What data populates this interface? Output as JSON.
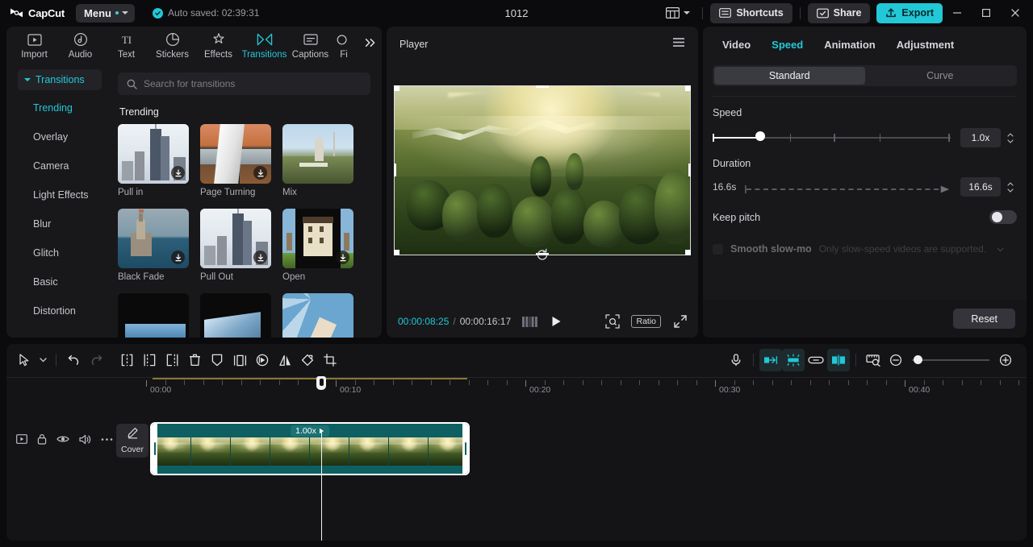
{
  "titlebar": {
    "brand": "CapCut",
    "menu_label": "Menu",
    "autosave": "Auto saved: 02:39:31",
    "project_title": "1012",
    "layout_icon": "layout-icon",
    "shortcuts_label": "Shortcuts",
    "share_label": "Share",
    "export_label": "Export",
    "minimize": "minimize-icon",
    "maximize": "maximize-icon",
    "close": "close-icon",
    "accent": "#22c8d6"
  },
  "media_panel": {
    "tabs": [
      {
        "label": "Import",
        "icon": "import-icon",
        "active": false
      },
      {
        "label": "Audio",
        "icon": "audio-icon",
        "active": false
      },
      {
        "label": "Text",
        "icon": "text-icon",
        "active": false
      },
      {
        "label": "Stickers",
        "icon": "stickers-icon",
        "active": false
      },
      {
        "label": "Effects",
        "icon": "effects-icon",
        "active": false
      },
      {
        "label": "Transitions",
        "icon": "transitions-icon",
        "active": true
      },
      {
        "label": "Captions",
        "icon": "captions-icon",
        "active": false
      },
      {
        "label": "Fi",
        "icon": "filters-icon",
        "active": false
      }
    ],
    "expand_icon": "chevron-double-right-icon",
    "category_header": "Transitions",
    "categories": [
      {
        "label": "Trending",
        "active": true
      },
      {
        "label": "Overlay",
        "active": false
      },
      {
        "label": "Camera",
        "active": false
      },
      {
        "label": "Light Effects",
        "active": false
      },
      {
        "label": "Blur",
        "active": false
      },
      {
        "label": "Glitch",
        "active": false
      },
      {
        "label": "Basic",
        "active": false
      },
      {
        "label": "Distortion",
        "active": false
      }
    ],
    "search": {
      "placeholder": "Search for transitions",
      "value": "",
      "icon": "search-icon"
    },
    "section_title": "Trending",
    "items": [
      {
        "name": "Pull in",
        "art": "tn-city",
        "download": true,
        "selected": true
      },
      {
        "name": "Page Turning",
        "art": "tn-page",
        "download": true,
        "selected": false
      },
      {
        "name": "Mix",
        "art": "tn-hill",
        "download": false,
        "selected": false
      },
      {
        "name": "Black Fade",
        "art": "tn-tower",
        "download": true,
        "selected": false
      },
      {
        "name": "Pull Out",
        "art": "tn-city",
        "download": true,
        "selected": true
      },
      {
        "name": "Open",
        "art": "tn-open",
        "download": true,
        "selected": false
      }
    ]
  },
  "player": {
    "title": "Player",
    "menu_icon": "hamburger-icon",
    "reset_rotation_icon": "reset-rotation-icon",
    "current_time": "00:00:08:25",
    "time_separator": "/",
    "total_time": "00:00:16:17",
    "quality_icon": "quality-bars-icon",
    "play_icon": "play-icon",
    "zoom_fit_icon": "zoom-fit-icon",
    "ratio_label": "Ratio",
    "fullscreen_icon": "fullscreen-icon"
  },
  "inspector": {
    "tabs": [
      {
        "label": "Video",
        "active": false
      },
      {
        "label": "Speed",
        "active": true
      },
      {
        "label": "Animation",
        "active": false
      },
      {
        "label": "Adjustment",
        "active": false
      }
    ],
    "modes": [
      {
        "label": "Standard",
        "active": true
      },
      {
        "label": "Curve",
        "active": false
      }
    ],
    "speed_label": "Speed",
    "speed_value": "1.0x",
    "speed_knob_pct": 20,
    "duration_label": "Duration",
    "duration_current": "16.6s",
    "duration_value": "16.6s",
    "keep_pitch_label": "Keep pitch",
    "keep_pitch_on": false,
    "smooth_slowmo_label": "Smooth slow-mo",
    "smooth_slowmo_hint": "Only slow-speed videos are supported.",
    "reset_label": "Reset"
  },
  "timeline": {
    "tools_left": [
      {
        "icon": "select-cursor-icon",
        "state": "normal"
      },
      {
        "icon": "chevron-down-icon",
        "state": "normal"
      },
      {
        "icon": "undo-icon",
        "state": "normal"
      },
      {
        "icon": "redo-icon",
        "state": "disabled"
      },
      {
        "icon": "split-icon",
        "state": "normal"
      },
      {
        "icon": "trim-left-icon",
        "state": "normal"
      },
      {
        "icon": "trim-right-icon",
        "state": "normal"
      },
      {
        "icon": "delete-icon",
        "state": "normal"
      },
      {
        "icon": "marker-icon",
        "state": "normal"
      },
      {
        "icon": "freeze-frame-icon",
        "state": "normal"
      },
      {
        "icon": "reverse-icon",
        "state": "normal"
      },
      {
        "icon": "mirror-icon",
        "state": "normal"
      },
      {
        "icon": "rotate-icon",
        "state": "normal"
      },
      {
        "icon": "crop-icon",
        "state": "normal"
      }
    ],
    "tools_right": [
      {
        "icon": "microphone-icon",
        "state": "normal"
      },
      {
        "icon": "magnetic-snap-icon",
        "state": "active"
      },
      {
        "icon": "auto-snap-icon",
        "state": "active"
      },
      {
        "icon": "link-icon",
        "state": "normal"
      },
      {
        "icon": "split-view-icon",
        "state": "active"
      },
      {
        "icon": "preview-ruler-icon",
        "state": "normal"
      },
      {
        "icon": "zoom-out-icon",
        "state": "normal"
      },
      {
        "icon": "zoom-in-icon",
        "state": "normal"
      }
    ],
    "ruler_labels": [
      "00:00",
      "00:10",
      "00:20",
      "00:30",
      "00:40"
    ],
    "track_icons": [
      "video-track-icon",
      "lock-icon",
      "eye-icon",
      "speaker-icon",
      "more-icon"
    ],
    "cover_label": "Cover",
    "cover_icon": "pencil-icon",
    "clip": {
      "speed_badge": "1.00x",
      "speed_badge_icon": "play-small-icon"
    },
    "zoom_slider_pct": 4
  }
}
